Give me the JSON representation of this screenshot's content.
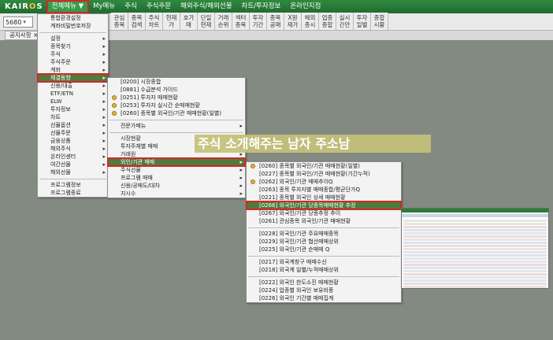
{
  "app": {
    "logo_main": "KAIR",
    "logo_o": "O",
    "logo_end": "S"
  },
  "top_menu": [
    {
      "label": "전체메뉴 ▼",
      "active": true
    },
    {
      "label": "My메뉴"
    },
    {
      "label": "주식"
    },
    {
      "label": "주식주문"
    },
    {
      "label": "해외주식/해외선물"
    },
    {
      "label": "차트/투자정보"
    },
    {
      "label": "온라인지점"
    }
  ],
  "toolbar": {
    "code_value": "5680",
    "code_dropdown": "▾",
    "buttons": [
      "관심\n종목",
      "종목\n검색",
      "주식\n차트",
      "현재\n가",
      "호가\n매",
      "단일\n현재",
      "거래\n순위",
      "섹터\n종목",
      "투자\n기간",
      "종목\n공매",
      "X원\n재가",
      "해외\n종시",
      "업종\n종합",
      "실시\n간안",
      "투자\n일별",
      "종합\n시황"
    ]
  },
  "tabs": {
    "notice": "공지사항 ×"
  },
  "menu_level1": {
    "items": [
      {
        "label": "통합환경설정"
      },
      {
        "label": "계좌비밀번호저장"
      },
      {
        "sep": true
      },
      {
        "label": "설정",
        "sub": true
      },
      {
        "label": "종목찾기",
        "sub": true
      },
      {
        "label": "주식",
        "sub": true
      },
      {
        "label": "주식주문",
        "sub": true
      },
      {
        "label": "계좌",
        "sub": true
      },
      {
        "label": "체결동향",
        "sub": true,
        "hl": true,
        "boxed": true
      },
      {
        "label": "신용/대출",
        "sub": true
      },
      {
        "label": "ETF/ETN",
        "sub": true
      },
      {
        "label": "ELW",
        "sub": true
      },
      {
        "label": "투자정보",
        "sub": true
      },
      {
        "label": "차트",
        "sub": true
      },
      {
        "label": "선물옵션",
        "sub": true
      },
      {
        "label": "선물주문",
        "sub": true
      },
      {
        "label": "금융상품",
        "sub": true
      },
      {
        "label": "해외주식",
        "sub": true
      },
      {
        "label": "온라인센터",
        "sub": true
      },
      {
        "label": "여간선물",
        "sub": true
      },
      {
        "label": "해외선물",
        "sub": true
      },
      {
        "sep": true
      },
      {
        "label": "프로그램정보"
      },
      {
        "label": "프로그램종료"
      }
    ]
  },
  "menu_level2": {
    "items": [
      {
        "label": "[0200] 시장종합"
      },
      {
        "label": "[0881] 수급분석 가이드"
      },
      {
        "label": "[0251] 투자자 매매현황",
        "icon": "gold"
      },
      {
        "label": "[0253] 투자자 실시간 순매매현황",
        "icon": "gold"
      },
      {
        "label": "[0260] 종목별 외국인/기관 매매현황(일별)",
        "icon": "gold"
      },
      {
        "sep": true
      },
      {
        "label": "전문가메뉴",
        "sub": true
      },
      {
        "sep": true
      },
      {
        "label": "시장현황",
        "sub": true
      },
      {
        "label": "투자주체별 매매",
        "sub": true
      },
      {
        "label": "거래원",
        "sub": true
      },
      {
        "label": "외인/기관 매매",
        "sub": true,
        "hl": true,
        "boxed": true
      },
      {
        "label": "주식선물",
        "sub": true
      },
      {
        "label": "프로그램 매매",
        "sub": true
      },
      {
        "label": "신용/공매도/대차",
        "sub": true
      },
      {
        "label": "지시수",
        "sub": true
      }
    ]
  },
  "menu_level3": {
    "items": [
      {
        "label": "[0260] 종목별 외국인/기관 매매현황(일별)",
        "icon": "gold"
      },
      {
        "label": "[0227] 종목별 외국인/기관 매매현황(기간누적)"
      },
      {
        "label": "[0262] 외국인/기관 매매추이Q",
        "icon": "gold"
      },
      {
        "label": "[0263] 종목 투자자별 매매종합/평균단가Q"
      },
      {
        "label": "[0221] 종목별 외국인 상세 매매현황"
      },
      {
        "label": "[0266] 외국인/기관 당종목매매현황 추정",
        "hl": true,
        "boxed": true
      },
      {
        "label": "[0267] 외국인/기관 당종추정 추이"
      },
      {
        "label": "[0261] 관심종목 외국인/기관 매매현황"
      },
      {
        "sep": true
      },
      {
        "label": "[0228] 외국인/기관 주요매매종목"
      },
      {
        "label": "[0229] 외국인/기관 협산매매상위"
      },
      {
        "label": "[0225] 외국인/기관 순매매 Q"
      },
      {
        "sep": true
      },
      {
        "label": "[0217] 외국계창구 매매수신"
      },
      {
        "label": "[0218] 외국계 일별/누적매매상위"
      },
      {
        "sep": true
      },
      {
        "label": "[0222] 외국인 한도소진 매매현황"
      },
      {
        "label": "[0224] 업종별 외국인 보유비중"
      },
      {
        "label": "[0226] 외국인 기간별 매매집계"
      }
    ]
  },
  "overlay": {
    "caption": "주식 소개해주는 남자 주소남"
  }
}
